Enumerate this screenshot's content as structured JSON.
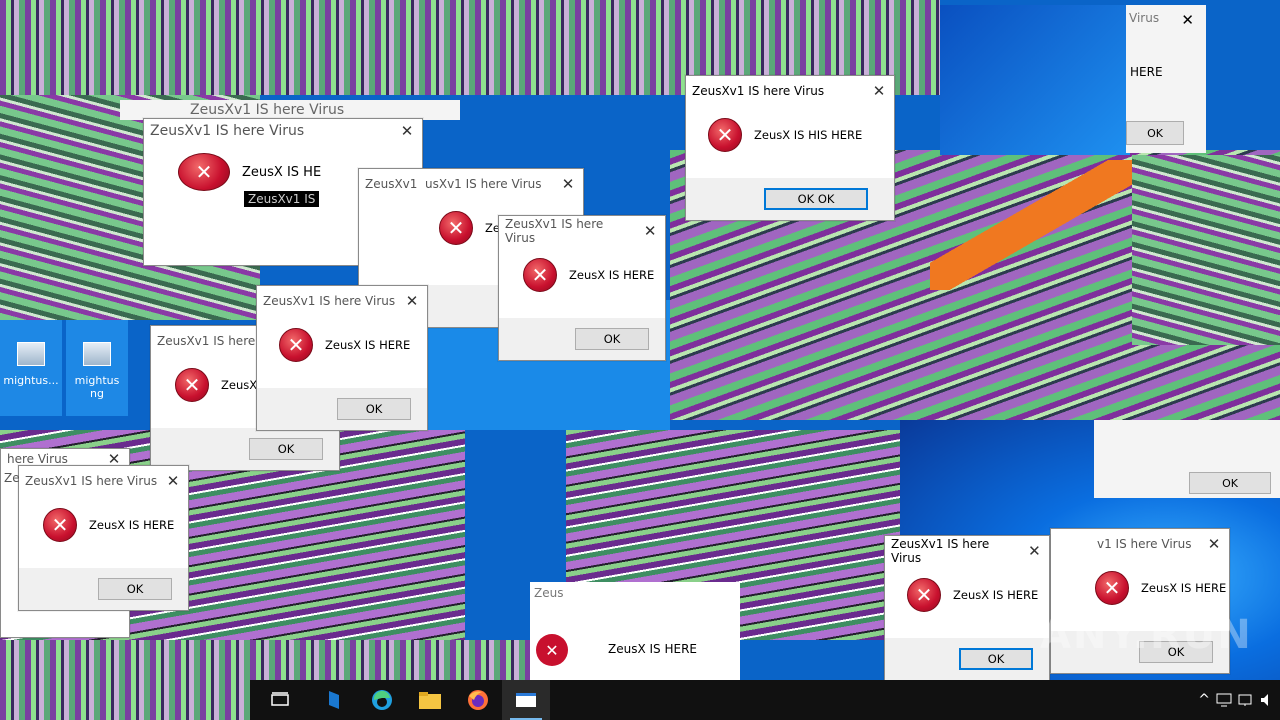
{
  "dialog": {
    "title": "ZeusXv1 IS here Virus",
    "message": "ZeusX IS HERE",
    "message_variant": "ZeusX IS HIS HERE",
    "ok_label": "OK",
    "ok_label_variant": "OK OK",
    "close_glyph": "✕",
    "error_glyph": "✕"
  },
  "fragments": {
    "title_partial_1": "ZeusXv1",
    "title_partial_2": "usXv1 IS here Virus",
    "title_partial_3": "here Virus",
    "title_partial_4": "Ze",
    "title_partial_5": "Zeus",
    "title_partial_6": "ZeusXv1 IS here Virus",
    "title_partial_7": "v1 IS here Virus",
    "title_partial_8": "Zeus",
    "title_partial_9": "ZeusXv1 IS here",
    "title_partial_10": "Virus",
    "message_partial_1": "ZeusX IS HE",
    "message_partial_2": "ZeusX",
    "message_partial_3": "Ze",
    "message_partial_4": "HERE",
    "message_partial_5": "ZeusX IS HERE",
    "message_partial_6": "ZeusX IS HERE",
    "glitch_label": "ZeusXv1 IS",
    "ok_partial": "OK",
    "ok_partial_2": "OK"
  },
  "desktop": {
    "icons": [
      {
        "label": "mightus..."
      },
      {
        "label": "mightus ng"
      }
    ]
  },
  "taskbar": {
    "task_view_icon": "task-view",
    "apps": [
      "edge",
      "file-explorer",
      "firefox",
      "zeus-dialog"
    ],
    "tray_chevron": "^"
  },
  "watermark": "ANY.RUN",
  "colors": {
    "accent": "#0078d7",
    "error_red": "#c8102e",
    "taskbar": "#111111",
    "glitch_purple": "#7a3fa0",
    "glitch_green": "#8fe08f"
  }
}
